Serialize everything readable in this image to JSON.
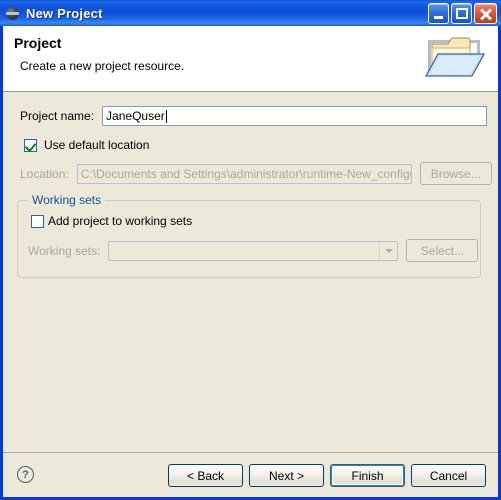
{
  "window": {
    "title": "New Project",
    "icon": "globe-icon",
    "controls": {
      "minimize": "Minimize",
      "maximize": "Maximize",
      "close": "Close"
    }
  },
  "header": {
    "title": "Project",
    "description": "Create a new project resource.",
    "banner_icon": "open-folder-icon"
  },
  "form": {
    "project_name": {
      "label": "Project name:",
      "value": "JaneQuser"
    },
    "use_default_location": {
      "label": "Use default location",
      "checked": true
    },
    "location": {
      "label": "Location:",
      "value": "C:\\Documents and Settings\\administrator\\runtime-New_configurati",
      "enabled": false
    },
    "browse_button": {
      "label": "Browse...",
      "enabled": false
    }
  },
  "working_sets": {
    "legend": "Working sets",
    "add_checkbox": {
      "label": "Add project to working sets",
      "checked": false
    },
    "combo": {
      "label": "Working sets:",
      "value": "",
      "enabled": false
    },
    "select_button": {
      "label": "Select...",
      "enabled": false
    }
  },
  "footer": {
    "help": "?",
    "back": "< Back",
    "next": "Next >",
    "finish": "Finish",
    "cancel": "Cancel"
  },
  "colors": {
    "dialog_bg": "#ECE9D8",
    "title_blue": "#0B56D8",
    "legend_blue": "#1A4B9E",
    "disabled_text": "#ACA899"
  }
}
